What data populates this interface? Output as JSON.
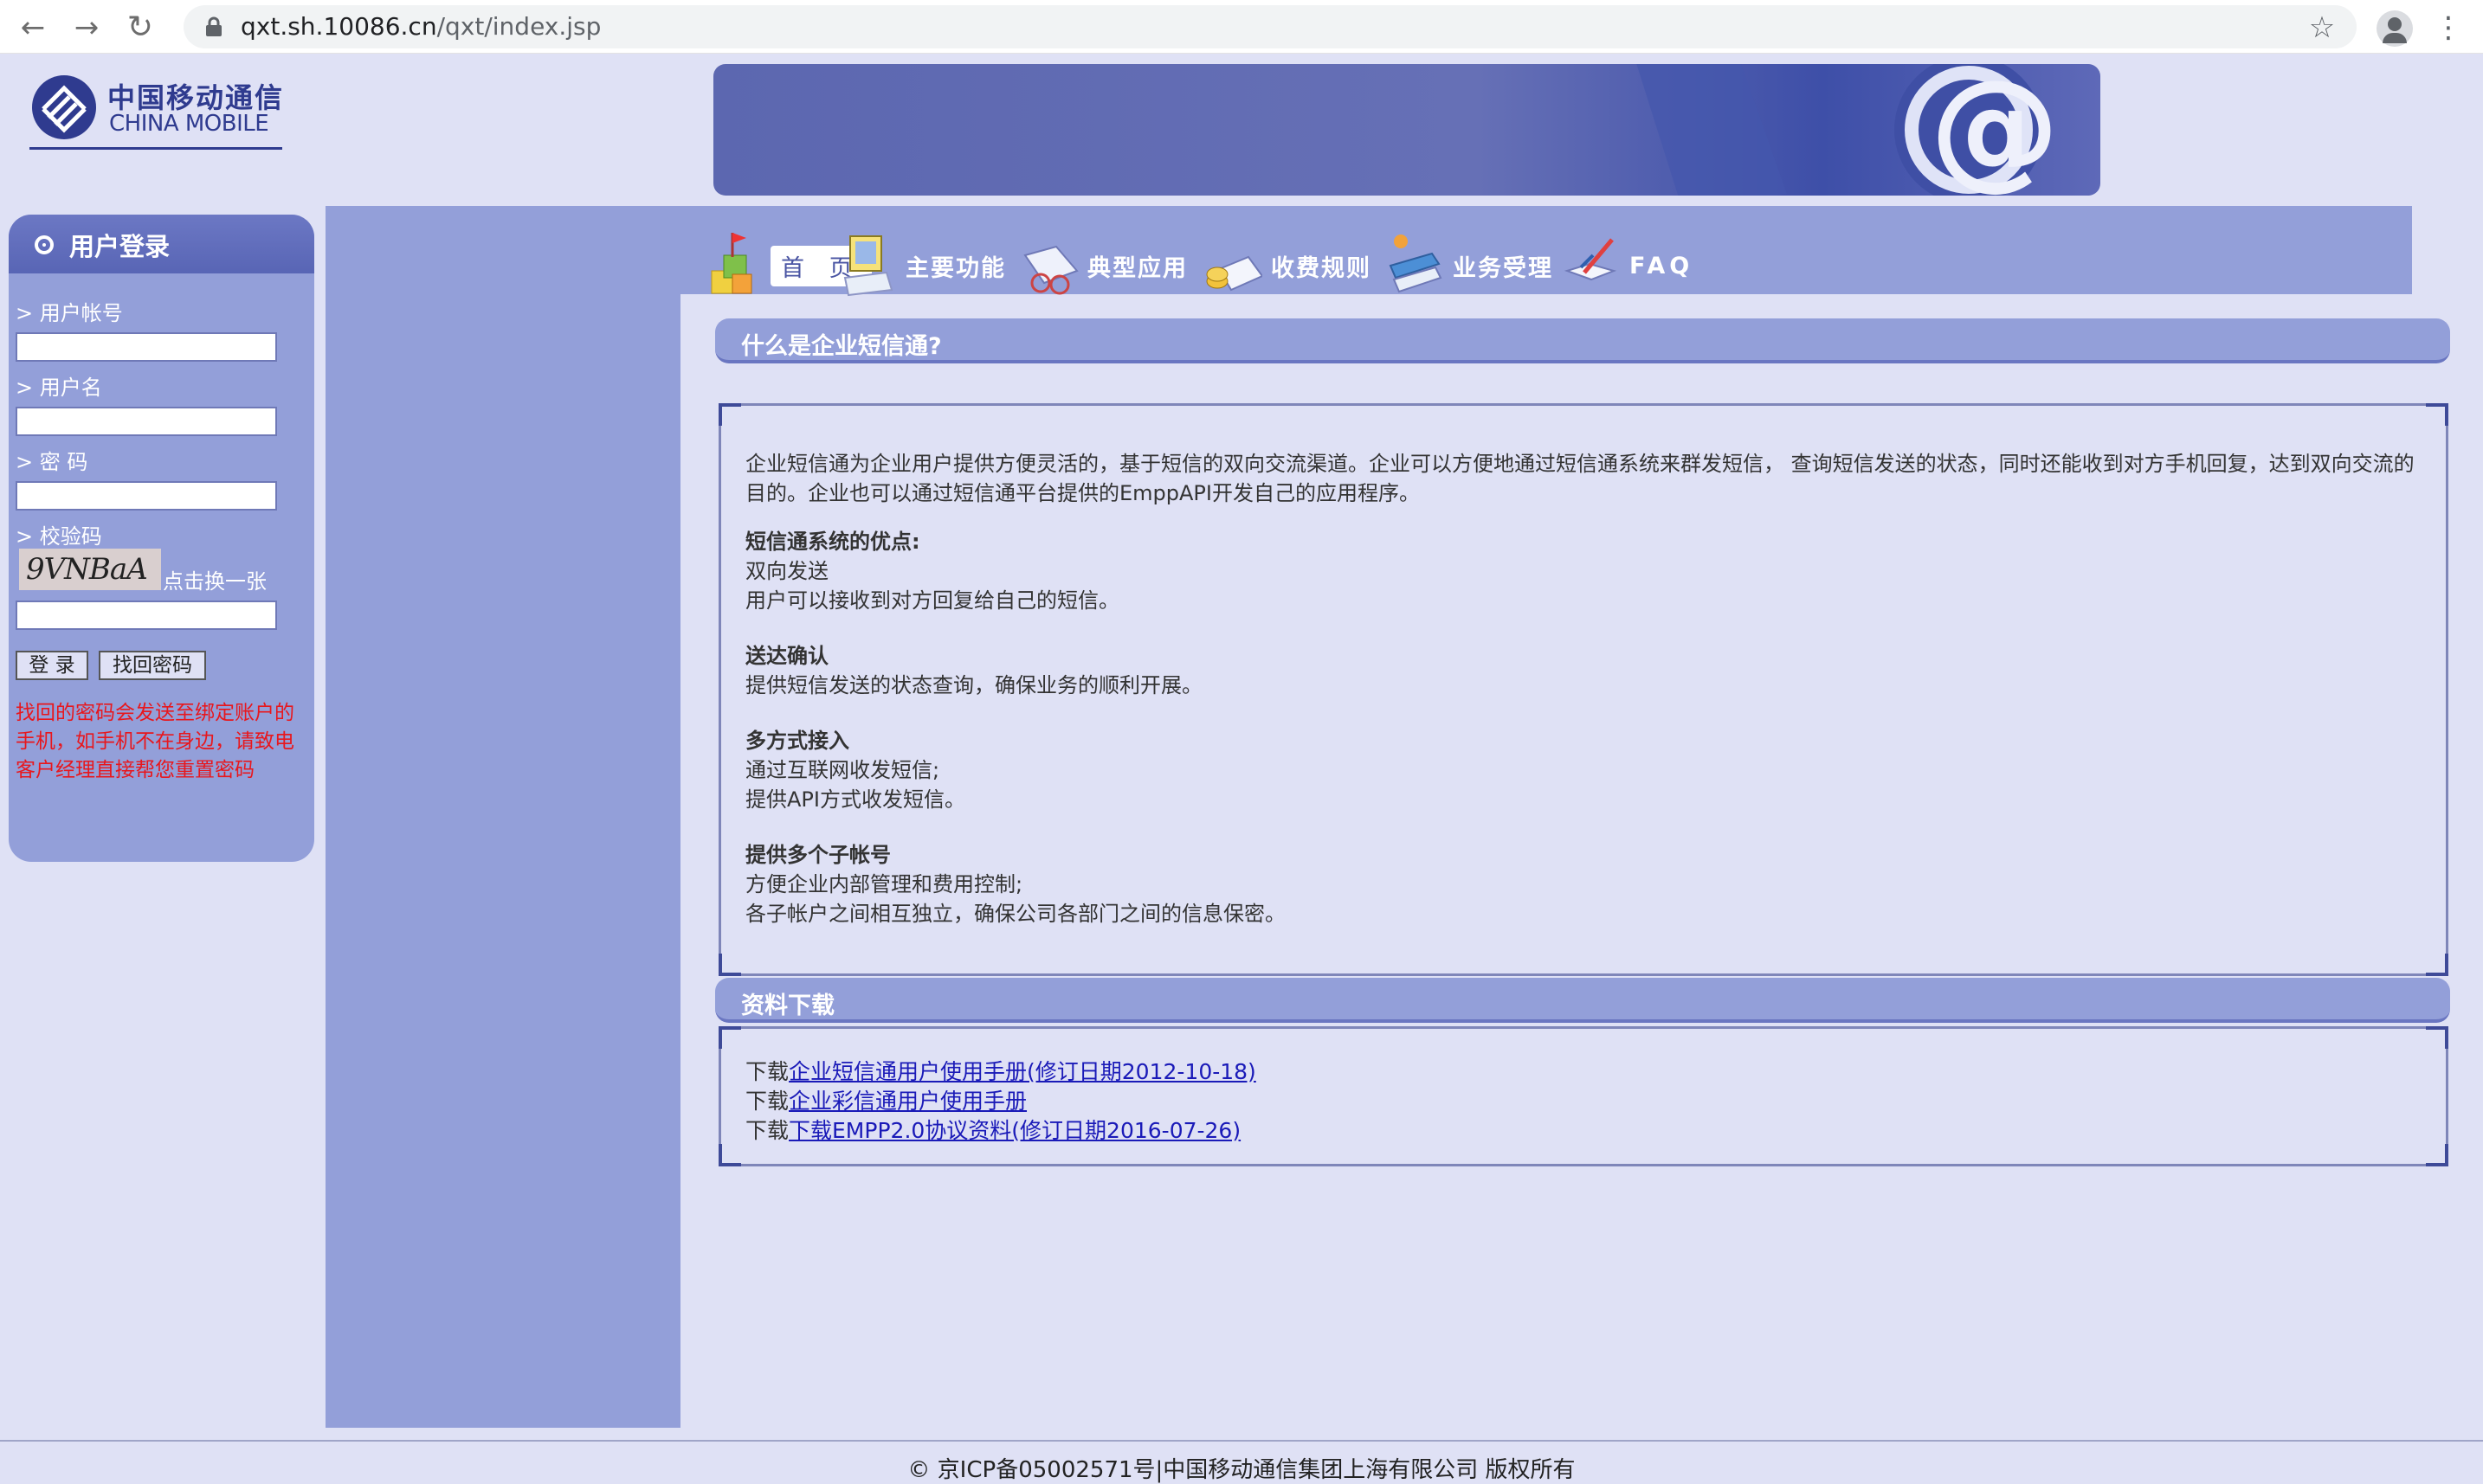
{
  "browser": {
    "url_host": "qxt.sh.10086.cn",
    "url_path": "/qxt/index.jsp",
    "icons": [
      "back-icon",
      "forward-icon",
      "reload-icon",
      "lock-icon",
      "star-icon",
      "profile-icon",
      "menu-icon"
    ]
  },
  "header": {
    "logo_cn": "中国移动通信",
    "logo_en": "CHINA MOBILE"
  },
  "nav": {
    "items": [
      {
        "label": "首 页"
      },
      {
        "label": "主要功能"
      },
      {
        "label": "典型应用"
      },
      {
        "label": "收费规则"
      },
      {
        "label": "业务受理"
      },
      {
        "label": "FAQ"
      }
    ]
  },
  "login": {
    "title": "用户登录",
    "account_label": "> 用户帐号",
    "username_label": "> 用户名",
    "password_label": "> 密 码",
    "captcha_label": "> 校验码",
    "captcha_text": "9VNBaA",
    "refresh_captcha": "点击换一张",
    "login_button": "登 录",
    "recover_button": "找回密码",
    "recover_notice": "找回的密码会发送至绑定账户的手机，如手机不在身边，请致电客户经理直接帮您重置密码"
  },
  "intro": {
    "title": "什么是企业短信通?",
    "paragraph": "企业短信通为企业用户提供方便灵活的，基于短信的双向交流渠道。企业可以方便地通过短信通系统来群发短信， 查询短信发送的状态，同时还能收到对方手机回复，达到双向交流的目的。企业也可以通过短信通平台提供的EmppAPI开发自己的应用程序。",
    "advantages_heading": "短信通系统的优点:",
    "features": [
      {
        "heading": "双向发送",
        "lines": [
          "用户可以接收到对方回复给自己的短信。"
        ],
        "bold": false
      },
      {
        "heading": "送达确认",
        "lines": [
          "提供短信发送的状态查询，确保业务的顺利开展。"
        ],
        "bold": true
      },
      {
        "heading": "多方式接入",
        "lines": [
          "通过互联网收发短信;",
          "提供API方式收发短信。"
        ],
        "bold": true
      },
      {
        "heading": "提供多个子帐号",
        "lines": [
          "方便企业内部管理和费用控制;",
          "各子帐户之间相互独立，确保公司各部门之间的信息保密。"
        ],
        "bold": true
      }
    ]
  },
  "downloads": {
    "title": "资料下载",
    "prefix": "下载",
    "items": [
      {
        "link": "企业短信通用户使用手册(修订日期2012-10-18)"
      },
      {
        "link": "企业彩信通用户使用手册"
      },
      {
        "link": "下载EMPP2.0协议资料(修订日期2016-07-26)"
      }
    ]
  },
  "footer": {
    "text": "© 京ICP备05002571号|中国移动通信集团上海有限公司 版权所有"
  },
  "colors": {
    "page_bg": "#dfe1f5",
    "panel": "#939fd9",
    "header_band": "#5865b5",
    "link": "#1a1ab8",
    "warning": "#e8171d"
  }
}
